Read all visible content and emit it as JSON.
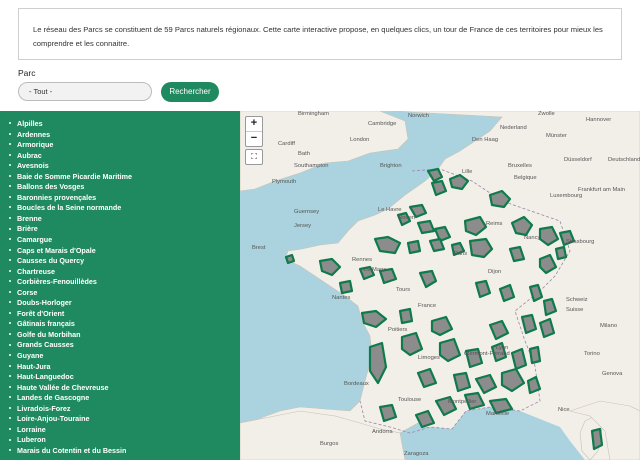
{
  "intro": {
    "text": "Le réseau des Parcs se constituent de 59 Parcs naturels régionaux. Cette carte interactive propose, en quelques clics, un tour de France de ces territoires pour mieux les comprendre et les connaitre."
  },
  "search": {
    "label": "Parc",
    "select_value": "- Tout -",
    "button_label": "Rechercher"
  },
  "parks": [
    "Alpilles",
    "Ardennes",
    "Armorique",
    "Aubrac",
    "Avesnois",
    "Baie de Somme Picardie Maritime",
    "Ballons des Vosges",
    "Baronnies provençales",
    "Boucles de la Seine normande",
    "Brenne",
    "Brière",
    "Camargue",
    "Caps et Marais d'Opale",
    "Causses du Quercy",
    "Chartreuse",
    "Corbières-Fenouillèdes",
    "Corse",
    "Doubs-Horloger",
    "Forêt d'Orient",
    "Gâtinais français",
    "Golfe du Morbihan",
    "Grands Causses",
    "Guyane",
    "Haut-Jura",
    "Haut-Languedoc",
    "Haute Vallée de Chevreuse",
    "Landes de Gascogne",
    "Livradois-Forez",
    "Loire-Anjou-Touraine",
    "Lorraine",
    "Luberon",
    "Marais du Cotentin et du Bessin"
  ],
  "map": {
    "zoom_in": "+",
    "zoom_out": "−",
    "fullscreen": "⛶",
    "labels": [
      {
        "text": "Birmingham"
      },
      {
        "text": "Norwich"
      },
      {
        "text": "Zwolle"
      },
      {
        "text": "Hannover"
      },
      {
        "text": "Cambridge"
      },
      {
        "text": "Nederland"
      },
      {
        "text": "Den Haag"
      },
      {
        "text": "Münster"
      },
      {
        "text": "Cardiff"
      },
      {
        "text": "London"
      },
      {
        "text": "Bath"
      },
      {
        "text": "Brighton"
      },
      {
        "text": "Southampton"
      },
      {
        "text": "Plymouth"
      },
      {
        "text": "Lille"
      },
      {
        "text": "Bruxelles"
      },
      {
        "text": "Belgique"
      },
      {
        "text": "Düsseldorf"
      },
      {
        "text": "Deutschland"
      },
      {
        "text": "Luxembourg"
      },
      {
        "text": "Frankfurt am Main"
      },
      {
        "text": "Guernsey"
      },
      {
        "text": "Jersey"
      },
      {
        "text": "Le Havre"
      },
      {
        "text": "Rouen"
      },
      {
        "text": "Paris"
      },
      {
        "text": "Reims"
      },
      {
        "text": "Brest"
      },
      {
        "text": "Rennes"
      },
      {
        "text": "Le Mans"
      },
      {
        "text": "Nancy"
      },
      {
        "text": "Strasbourg"
      },
      {
        "text": "Nantes"
      },
      {
        "text": "Tours"
      },
      {
        "text": "Dijon"
      },
      {
        "text": "France"
      },
      {
        "text": "Poitiers"
      },
      {
        "text": "Schweiz"
      },
      {
        "text": "Suisse"
      },
      {
        "text": "Limoges"
      },
      {
        "text": "Lyon"
      },
      {
        "text": "Clermont-Ferrand"
      },
      {
        "text": "Bordeaux"
      },
      {
        "text": "Torino"
      },
      {
        "text": "Milano"
      },
      {
        "text": "Genova"
      },
      {
        "text": "Toulouse"
      },
      {
        "text": "Montpellier"
      },
      {
        "text": "Marseille"
      },
      {
        "text": "Nice"
      },
      {
        "text": "Andorra"
      },
      {
        "text": "Zaragoza"
      },
      {
        "text": "Burgos"
      }
    ]
  }
}
